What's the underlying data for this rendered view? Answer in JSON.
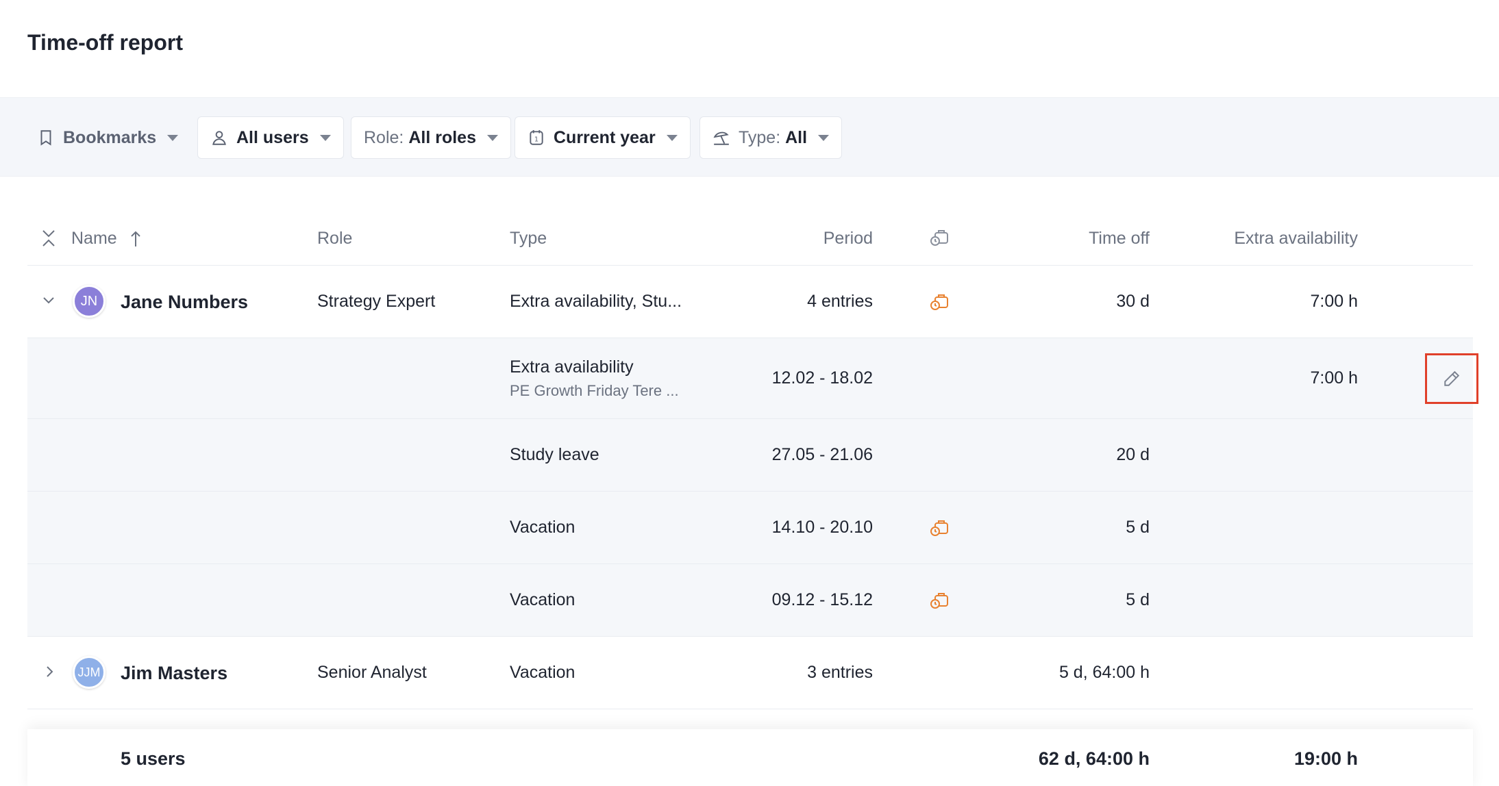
{
  "page": {
    "title": "Time-off report"
  },
  "filters": {
    "bookmarks": {
      "label": "Bookmarks",
      "icon": "bookmark-icon"
    },
    "users": {
      "label": "All users",
      "icon": "user-icon"
    },
    "role": {
      "prefix": "Role:",
      "value": "All roles"
    },
    "period": {
      "label": "Current year",
      "icon": "calendar-icon"
    },
    "type": {
      "prefix": "Type:",
      "value": "All",
      "icon": "beach-umbrella-icon"
    }
  },
  "table": {
    "columns": {
      "name": "Name",
      "role": "Role",
      "type": "Type",
      "period": "Period",
      "approval_icon": "timer-briefcase-icon",
      "time_off": "Time off",
      "extra_availability": "Extra availability"
    },
    "rows": [
      {
        "initials": "JN",
        "name": "Jane Numbers",
        "role": "Strategy Expert",
        "type": "Extra availability, Stu...",
        "period": "4 entries",
        "time_off": "30 d",
        "extra": "7:00 h",
        "expanded": true,
        "avatar_color": "#8b7fd9",
        "entries": [
          {
            "type": "Extra availability",
            "note": "PE Growth Friday Tere ...",
            "period": "12.02 - 18.02",
            "time_off": "",
            "extra": "7:00 h"
          },
          {
            "type": "Study leave",
            "period": "27.05 - 21.06",
            "time_off": "20 d",
            "extra": ""
          },
          {
            "type": "Vacation",
            "period": "14.10 - 20.10",
            "time_off": "5 d",
            "extra": ""
          },
          {
            "type": "Vacation",
            "period": "09.12 - 15.12",
            "time_off": "5 d",
            "extra": ""
          }
        ]
      },
      {
        "initials": "JJM",
        "name": "Jim Masters",
        "role": "Senior Analyst",
        "type": "Vacation",
        "period": "3 entries",
        "time_off": "5 d, 64:00 h",
        "extra": "",
        "expanded": false,
        "avatar_color": "#8fb0e8"
      }
    ],
    "totals": {
      "users": "5 users",
      "time_off": "62 d, 64:00 h",
      "extra": "19:00 h"
    }
  },
  "colors": {
    "accent_orange": "#e8812f",
    "highlight_red": "#e0402a"
  }
}
